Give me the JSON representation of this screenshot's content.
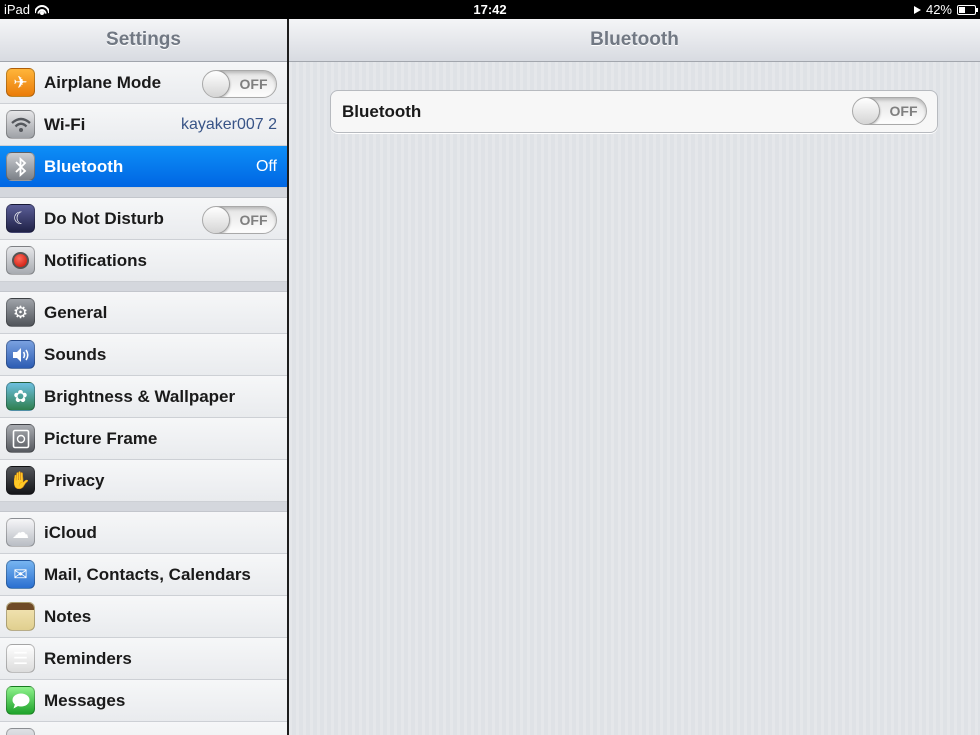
{
  "statusbar": {
    "device": "iPad",
    "time": "17:42",
    "battery": "42%",
    "battery_level": 0.42
  },
  "master": {
    "title": "Settings",
    "groups": [
      [
        {
          "label": "Airplane Mode",
          "icon": "airplane-icon",
          "toggle": "OFF"
        },
        {
          "label": "Wi-Fi",
          "icon": "wifi-icon",
          "value": "kayaker007 2"
        },
        {
          "label": "Bluetooth",
          "icon": "bluetooth-icon",
          "value": "Off",
          "selected": true
        }
      ],
      [
        {
          "label": "Do Not Disturb",
          "icon": "moon-icon",
          "toggle": "OFF"
        },
        {
          "label": "Notifications",
          "icon": "notifications-icon"
        }
      ],
      [
        {
          "label": "General",
          "icon": "gear-icon"
        },
        {
          "label": "Sounds",
          "icon": "speaker-icon"
        },
        {
          "label": "Brightness & Wallpaper",
          "icon": "flower-icon"
        },
        {
          "label": "Picture Frame",
          "icon": "picture-frame-icon"
        },
        {
          "label": "Privacy",
          "icon": "hand-icon"
        }
      ],
      [
        {
          "label": "iCloud",
          "icon": "cloud-icon"
        },
        {
          "label": "Mail, Contacts, Calendars",
          "icon": "mail-icon"
        },
        {
          "label": "Notes",
          "icon": "notes-icon"
        },
        {
          "label": "Reminders",
          "icon": "reminders-icon"
        },
        {
          "label": "Messages",
          "icon": "messages-icon"
        }
      ]
    ]
  },
  "detail": {
    "title": "Bluetooth",
    "bluetooth_label": "Bluetooth",
    "bluetooth_toggle": "OFF"
  },
  "colors": {
    "selected": "#0a7cf0",
    "value_text": "#385487",
    "airplane_orange": "#f08a17"
  }
}
